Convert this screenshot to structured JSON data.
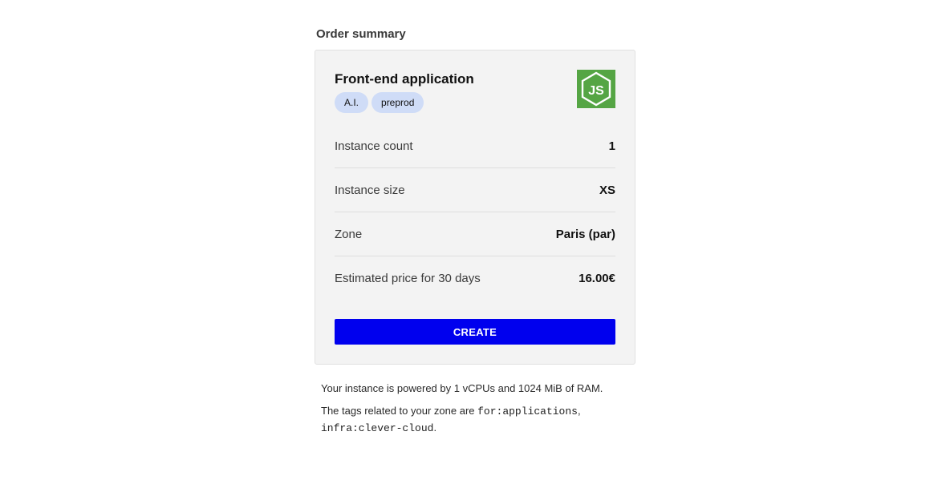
{
  "summary": {
    "title": "Order summary"
  },
  "app": {
    "name": "Front-end application",
    "tags": [
      "A.I.",
      "preprod"
    ],
    "logo_icon": "nodejs-icon",
    "logo_text": "JS",
    "logo_color": "#55a544"
  },
  "details": [
    {
      "label": "Instance count",
      "value": "1"
    },
    {
      "label": "Instance size",
      "value": "XS"
    },
    {
      "label": "Zone",
      "value": "Paris (par)"
    },
    {
      "label": "Estimated price for 30 days",
      "value": "16.00€"
    }
  ],
  "create_button": {
    "label": "CREATE",
    "color": "#0000ee"
  },
  "footnotes": {
    "powered_prefix": "Your instance is powered by 1 vCPUs and 1024 MiB of RAM.",
    "tags_prefix": "The tags related to your zone are ",
    "tag_1": "for:applications",
    "sep": ", ",
    "tag_2": "infra:clever-cloud",
    "end": "."
  }
}
